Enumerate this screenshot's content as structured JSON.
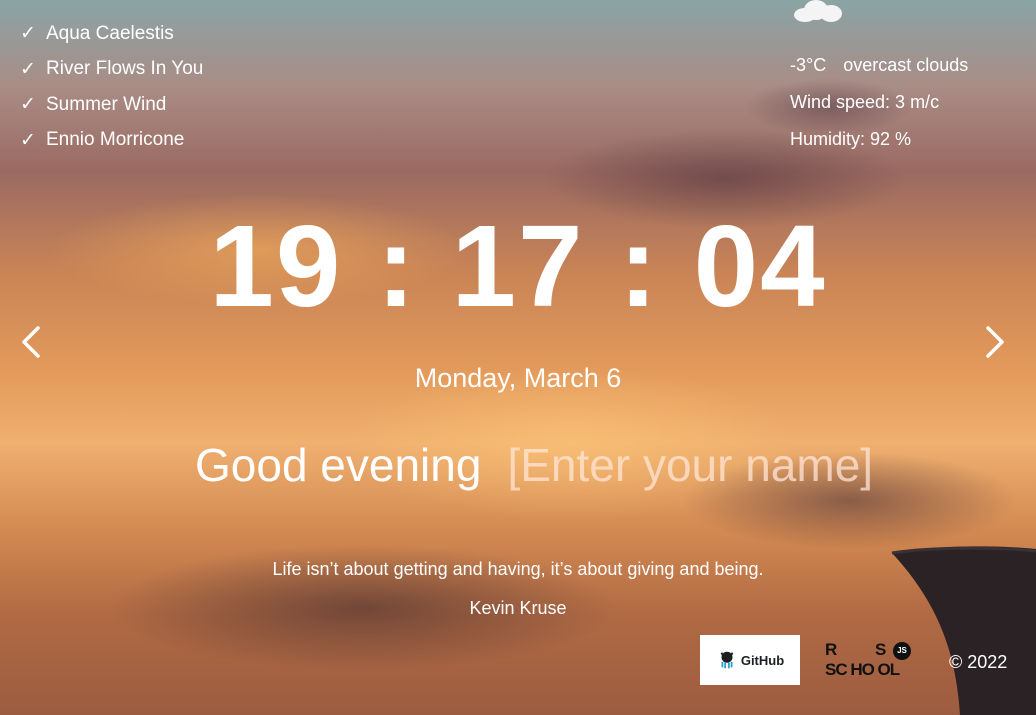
{
  "playlist": {
    "items": [
      {
        "check": "✓",
        "title": "Aqua Caelestis"
      },
      {
        "check": "✓",
        "title": "River Flows In You"
      },
      {
        "check": "✓",
        "title": "Summer Wind"
      },
      {
        "check": "✓",
        "title": "Ennio Morricone"
      }
    ]
  },
  "weather": {
    "icon": "cloud-icon",
    "temperature": "-3°C",
    "description": "overcast clouds",
    "wind": "Wind speed: 3 m/c",
    "humidity": "Humidity: 92 %"
  },
  "clock": {
    "time": "19 : 17 : 04",
    "date": "Monday, March 6"
  },
  "greeting": {
    "text": "Good evening",
    "name_placeholder": "[Enter your name]",
    "name_value": ""
  },
  "quote": {
    "text": "Life isn’t about getting and having, it’s about giving and being.",
    "author": "Kevin Kruse"
  },
  "footer": {
    "github_label": "GitHub",
    "rs_logo": {
      "r": "R",
      "s": "S",
      "line": "SC HO OL",
      "js": "JS"
    },
    "copyright": "© 2022"
  },
  "colors": {
    "text": "#ffffff",
    "placeholder": "#f2c9b8"
  }
}
